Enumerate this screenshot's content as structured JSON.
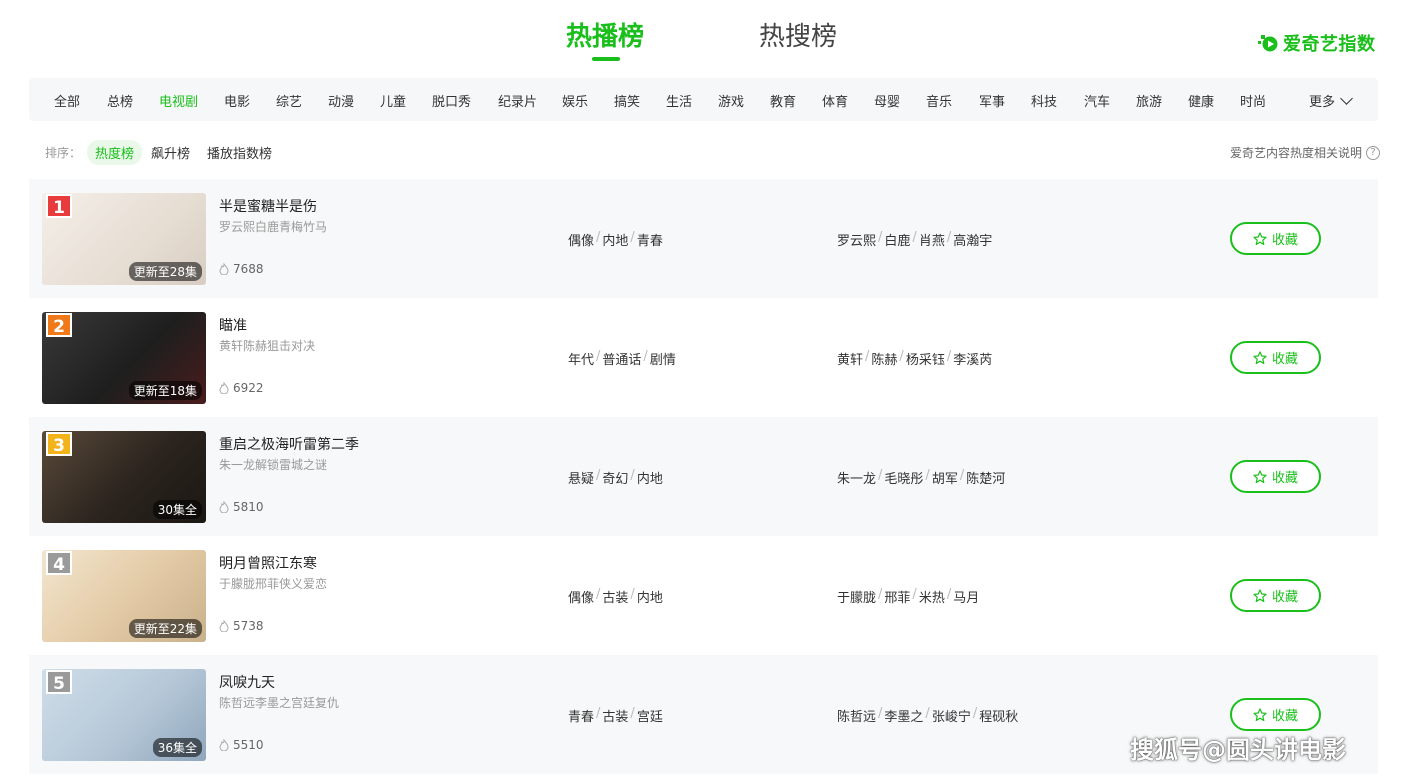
{
  "top_tabs": [
    {
      "label": "热播榜",
      "active": true
    },
    {
      "label": "热搜榜",
      "active": false
    }
  ],
  "logo": {
    "text": "爱奇艺指数"
  },
  "categories": [
    "全部",
    "总榜",
    "电视剧",
    "电影",
    "综艺",
    "动漫",
    "儿童",
    "脱口秀",
    "纪录片",
    "娱乐",
    "搞笑",
    "生活",
    "游戏",
    "教育",
    "体育",
    "母婴",
    "音乐",
    "军事",
    "科技",
    "汽车",
    "旅游",
    "健康",
    "时尚"
  ],
  "active_category": "电视剧",
  "more_label": "更多",
  "sort": {
    "label": "排序：",
    "options": [
      "热度榜",
      "飙升榜",
      "播放指数榜"
    ],
    "active": "热度榜"
  },
  "help_text": "爱奇艺内容热度相关说明",
  "fav_label": "收藏",
  "items": [
    {
      "rank": "1",
      "rank_color": "#e83b3b",
      "title": "半是蜜糖半是伤",
      "desc": "罗云熙白鹿青梅竹马",
      "episodes": "更新至28集",
      "heat": "7688",
      "tags": [
        "偶像",
        "内地",
        "青春"
      ],
      "cast": [
        "罗云熙",
        "白鹿",
        "肖燕",
        "高瀚宇"
      ]
    },
    {
      "rank": "2",
      "rank_color": "#f07a1a",
      "title": "瞄准",
      "desc": "黄轩陈赫狙击对决",
      "episodes": "更新至18集",
      "heat": "6922",
      "tags": [
        "年代",
        "普通话",
        "剧情"
      ],
      "cast": [
        "黄轩",
        "陈赫",
        "杨采钰",
        "李溪芮"
      ]
    },
    {
      "rank": "3",
      "rank_color": "#f2b31b",
      "title": "重启之极海听雷第二季",
      "desc": "朱一龙解锁雷城之谜",
      "episodes": "30集全",
      "heat": "5810",
      "tags": [
        "悬疑",
        "奇幻",
        "内地"
      ],
      "cast": [
        "朱一龙",
        "毛晓彤",
        "胡军",
        "陈楚河"
      ]
    },
    {
      "rank": "4",
      "rank_color": "#9a9a9a",
      "title": "明月曾照江东寒",
      "desc": "于朦胧邢菲侠义爱恋",
      "episodes": "更新至22集",
      "heat": "5738",
      "tags": [
        "偶像",
        "古装",
        "内地"
      ],
      "cast": [
        "于朦胧",
        "邢菲",
        "米热",
        "马月"
      ]
    },
    {
      "rank": "5",
      "rank_color": "#9a9a9a",
      "title": "凤唳九天",
      "desc": "陈哲远李墨之宫廷复仇",
      "episodes": "36集全",
      "heat": "5510",
      "tags": [
        "青春",
        "古装",
        "宫廷"
      ],
      "cast": [
        "陈哲远",
        "李墨之",
        "张峻宁",
        "程砚秋"
      ]
    }
  ],
  "watermark": "搜狐号@圆头讲电影"
}
